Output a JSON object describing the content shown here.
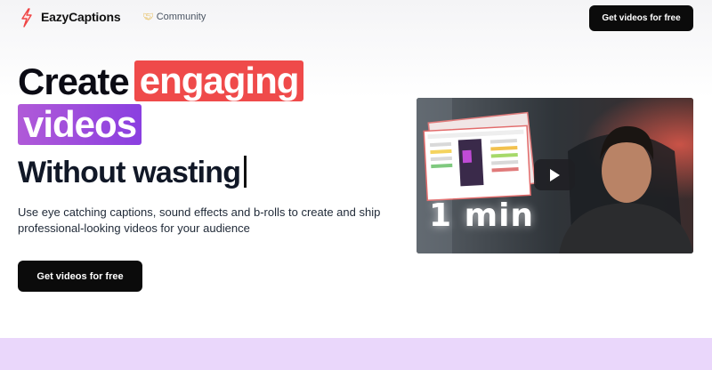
{
  "nav": {
    "brand": "EazyCaptions",
    "community": "Community",
    "cta": "Get videos for free"
  },
  "hero": {
    "line1_word": "Create",
    "line1_highlight": "engaging",
    "line2_highlight": "videos",
    "line3": "Without wasting",
    "subtitle": "Use eye catching captions, sound effects and b-rolls to create and ship professional-looking videos for your audience",
    "cta": "Get videos for free"
  },
  "video": {
    "overlay_text": "1 min",
    "play_icon": "play-icon"
  },
  "colors": {
    "highlight_red": "#ef4a4a",
    "highlight_purple": "#a24ce0",
    "button_dark": "#0b0b0b",
    "bottom_band": "#ead7fb"
  }
}
